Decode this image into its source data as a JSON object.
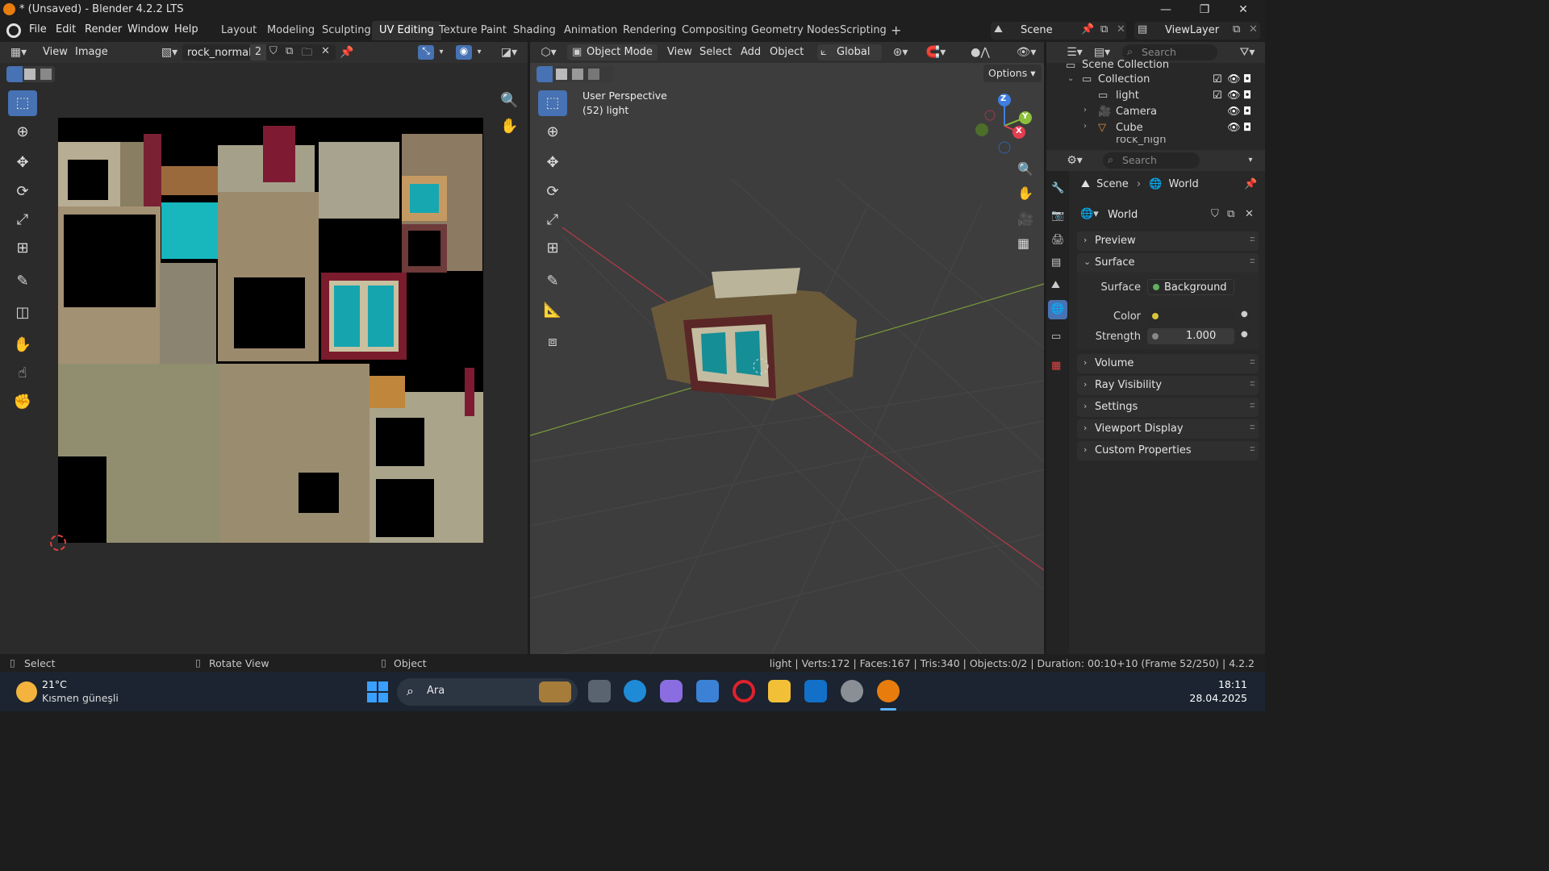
{
  "window": {
    "title": "* (Unsaved) - Blender 4.2.2 LTS",
    "controls": [
      "—",
      "❐",
      "✕"
    ]
  },
  "menubar": {
    "menus": [
      "File",
      "Edit",
      "Render",
      "Window",
      "Help"
    ],
    "workspaces": [
      "Layout",
      "Modeling",
      "Sculpting",
      "UV Editing",
      "Texture Paint",
      "Shading",
      "Animation",
      "Rendering",
      "Compositing",
      "Geometry Nodes",
      "Scripting"
    ],
    "active_workspace": "UV Editing",
    "add_tab": "+",
    "scene": "Scene",
    "view_layer": "ViewLayer"
  },
  "uv_editor": {
    "menus": [
      "View",
      "Image"
    ],
    "image_name": "rock_normal",
    "user_count": "2"
  },
  "viewport": {
    "mode": "Object Mode",
    "menus": [
      "View",
      "Select",
      "Add",
      "Object"
    ],
    "transform_orientation": "Global",
    "options_label": "Options",
    "overlay_title": "User Perspective",
    "overlay_object": "(52) light",
    "gizmo_axes": [
      "Z",
      "Y",
      "X"
    ]
  },
  "outliner": {
    "search_placeholder": "Search",
    "root": "Scene Collection",
    "collection": "Collection",
    "items": [
      "light",
      "Camera",
      "Cube",
      "rock_high"
    ]
  },
  "properties": {
    "search_placeholder": "Search",
    "breadcrumb": [
      "Scene",
      "World"
    ],
    "world_name": "World",
    "panels": {
      "preview": "Preview",
      "surface": "Surface",
      "volume": "Volume",
      "ray_visibility": "Ray Visibility",
      "settings": "Settings",
      "viewport_display": "Viewport Display",
      "custom_properties": "Custom Properties"
    },
    "surface": {
      "surface_label": "Surface",
      "surface_value": "Background",
      "color_label": "Color",
      "strength_label": "Strength",
      "strength_value": "1.000"
    }
  },
  "statusbar": {
    "left": [
      "Select",
      "Rotate View",
      "Object"
    ],
    "right": "light | Verts:172 | Faces:167 | Tris:340 | Objects:0/2 | Duration: 00:10+10 (Frame 52/250) | 4.2.2"
  },
  "taskbar": {
    "weather_temp": "21°C",
    "weather_desc": "Kısmen güneşli",
    "search_label": "Ara",
    "time": "18:11",
    "date": "28.04.2025"
  },
  "colors": {
    "accent": "#4772b3",
    "blender_orange": "#e87d0d",
    "panel_bg": "#303030",
    "viewport_bg": "#3d3d3d",
    "axis_x": "#e23e4f",
    "axis_y": "#8cbf3b",
    "axis_z": "#3f7ee0"
  }
}
